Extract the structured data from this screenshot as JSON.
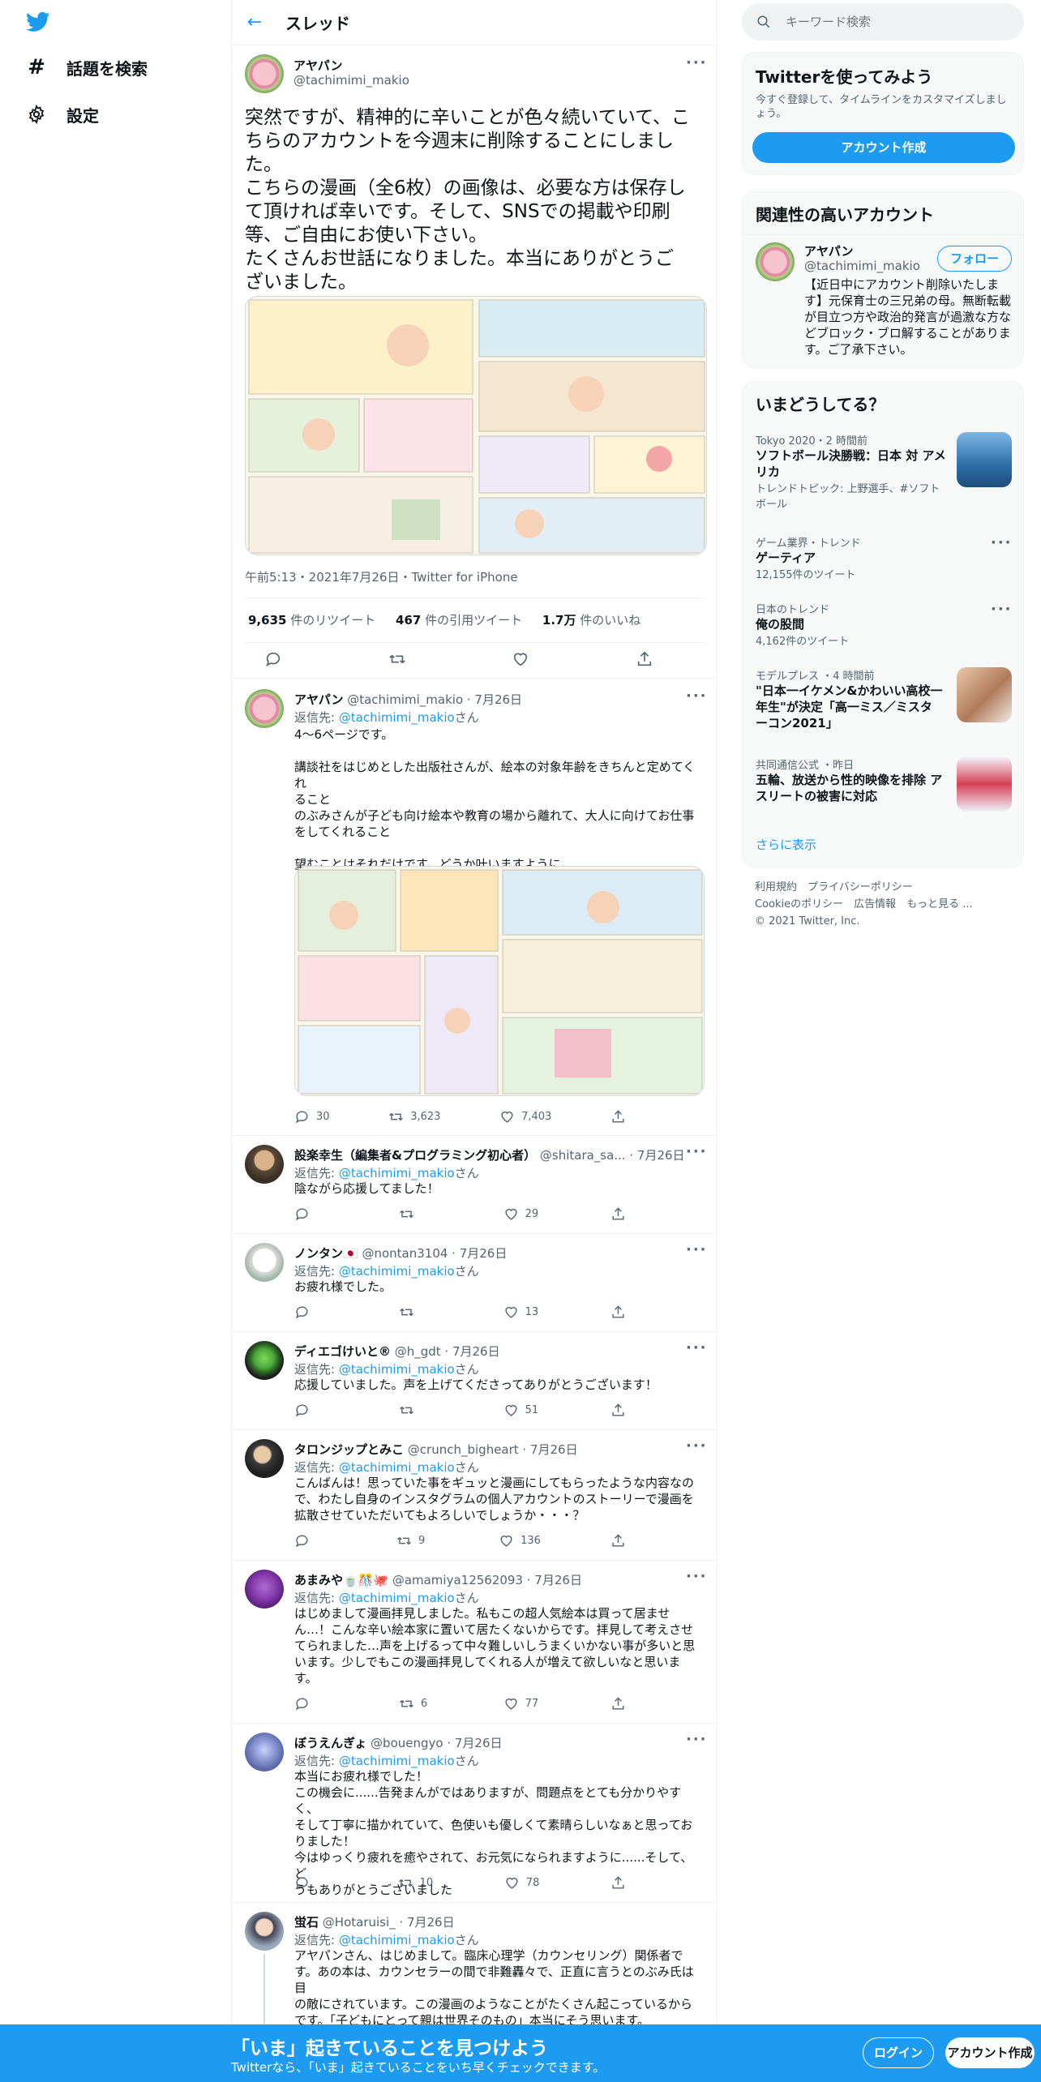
{
  "nav": {
    "explore": "話題を検索",
    "settings": "設定"
  },
  "header": {
    "title": "スレッド"
  },
  "main_tweet": {
    "name": "アヤパン",
    "handle": "@tachimimi_makio",
    "lines": [
      "突然ですが、精神的に辛いことが色々続いていて、こ",
      "ちらのアカウントを今週末に削除することにしまし",
      "た。",
      "こちらの漫画（全6枚）の画像は、必要な方は保存し",
      "て頂ければ幸いです。そして、SNSでの掲載や印刷",
      "等、ご自由にお使い下さい。",
      "たくさんお世話になりました。本当にありがとうご",
      "ざいました。"
    ],
    "timestamp": "午前5:13・2021年7月26日・Twitter for iPhone",
    "retweets": "9,635",
    "retweets_label": "件のリツイート",
    "quotes": "467",
    "quotes_label": "件の引用ツイート",
    "likes": "1.7万",
    "likes_label": "件のいいね"
  },
  "replies": [
    {
      "name": "アヤパン",
      "handle": "@tachimimi_makio · 7月26日",
      "reply_to_label": "返信先: ",
      "reply_to": "@tachimimi_makio",
      "reply_suffix": "さん",
      "lines": [
        "4〜6ページです。",
        "",
        "講談社をはじめとした出版社さんが、絵本の対象年齢をきちんと定めてくれ",
        "ること",
        "のぶみさんが子ども向け絵本や教育の場から離れて、大人に向けてお仕事",
        "をしてくれること",
        "",
        "望むことはそれだけです。どうか叶いますように。"
      ],
      "reply_count": "30",
      "retweet_count": "3,623",
      "like_count": "7,403"
    },
    {
      "name": "設楽幸生（編集者&プログラミング初心者）",
      "handle": "@shitara_sa... · 7月26日",
      "reply_to_label": "返信先: ",
      "reply_to": "@tachimimi_makio",
      "reply_suffix": "さん",
      "lines": [
        "陰ながら応援してました！"
      ],
      "reply_count": "",
      "retweet_count": "",
      "like_count": "29"
    },
    {
      "name": "ノンタン🇯🇵",
      "handle": "@nontan3104 · 7月26日",
      "reply_to_label": "返信先: ",
      "reply_to": "@tachimimi_makio",
      "reply_suffix": "さん",
      "lines": [
        "お疲れ様でした。"
      ],
      "reply_count": "",
      "retweet_count": "",
      "like_count": "13"
    },
    {
      "name": "ディエゴけいと®",
      "handle": "@h_gdt · 7月26日",
      "reply_to_label": "返信先: ",
      "reply_to": "@tachimimi_makio",
      "reply_suffix": "さん",
      "lines": [
        "応援していました。声を上げてくださってありがとうございます！"
      ],
      "reply_count": "",
      "retweet_count": "",
      "like_count": "51"
    },
    {
      "name": "タロンジップとみこ",
      "handle": "@crunch_bigheart · 7月26日",
      "reply_to_label": "返信先: ",
      "reply_to": "@tachimimi_makio",
      "reply_suffix": "さん",
      "lines": [
        "こんばんは！思っていた事をギュッと漫画にしてもらったような内容なの",
        "で、わたし自身のインスタグラムの個人アカウントのストーリーで漫画を",
        "拡散させていただいてもよろしいでしょうか・・・？"
      ],
      "reply_count": "",
      "retweet_count": "9",
      "like_count": "136"
    },
    {
      "name": "あまみや🍵🎊🐙",
      "handle": "@amamiya12562093 · 7月26日",
      "reply_to_label": "返信先: ",
      "reply_to": "@tachimimi_makio",
      "reply_suffix": "さん",
      "lines": [
        "はじめまして漫画拝見しました。私もこの超人気絵本は買って居ませ",
        "ん…！こんな辛い絵本家に置いて居たくないからです。拝見して考えさせ",
        "てられました…声を上げるって中々難しいしうまくいかない事が多いと思",
        "います。少しでもこの漫画拝見してくれる人が増えて欲しいなと思いま",
        "す。"
      ],
      "reply_count": "",
      "retweet_count": "6",
      "like_count": "77"
    },
    {
      "name": "ぼうえんぎょ",
      "handle": "@bouengyo · 7月26日",
      "reply_to_label": "返信先: ",
      "reply_to": "@tachimimi_makio",
      "reply_suffix": "さん",
      "lines": [
        "本当にお疲れ様でした！",
        "この機会に......告発まんがではありますが、問題点をとても分かりやすく、",
        "そして丁寧に描かれていて、色使いも優しくて素晴らしいなぁと思ってお",
        "りました！",
        "今はゆっくり疲れを癒やされて、お元気になられますように......そして、ど",
        "うもありがとうございました"
      ],
      "reply_count": "",
      "retweet_count": "10",
      "like_count": "78"
    },
    {
      "name": "蛍石",
      "handle": "@Hotaruisi_ · 7月26日",
      "reply_to_label": "返信先: ",
      "reply_to": "@tachimimi_makio",
      "reply_suffix": "さん",
      "lines": [
        "アヤパンさん、はじめまして。臨床心理学（カウンセリング）関係者で",
        "す。あの本は、カウンセラーの間で非難轟々で、正直に言うとのぶみ氏は目",
        "の敵にされています。この漫画のようなことがたくさん起こっているから",
        "です。「子どもにとって親は世界そのもの」本当にそう思います。"
      ]
    }
  ],
  "search": {
    "placeholder": "キーワード検索"
  },
  "signup": {
    "title": "Twitterを使ってみよう",
    "desc": "今すぐ登録して、タイムラインをカスタマイズしましょう。",
    "button": "アカウント作成"
  },
  "related": {
    "title": "関連性の高いアカウント",
    "name": "アヤパン",
    "handle": "@tachimimi_makio",
    "follow": "フォロー",
    "bio": [
      "【近日中にアカウント削除いたしま",
      "す】元保育士の三兄弟の母。無断転載",
      "が目立つ方や政治的発言が過激な方な",
      "どブロック・ブロ解することがありま",
      "す。ご了承下さい。"
    ]
  },
  "trends": {
    "title": "いまどうしてる？",
    "items": [
      {
        "meta": "Tokyo 2020・2 時間前",
        "name": "ソフトボール決勝戦：日本 対 アメリカ",
        "topic": "トレンドトピック: 上野選手、#ソフトボール"
      },
      {
        "meta": "ゲーム業界・トレンド",
        "name": "ゲーティア",
        "cnt": "12,155件のツイート"
      },
      {
        "meta": "日本のトレンド",
        "name": "俺の股間",
        "cnt": "4,162件のツイート"
      },
      {
        "meta": "モデルプレス ・4 時間前",
        "name": "\"日本一イケメン&かわいい高校一年生\"が決定「高一ミス／ミスターコン2021」"
      },
      {
        "meta": "共同通信公式 ・昨日",
        "name": "五輪、放送から性的映像を排除 アスリートの被害に対応"
      }
    ],
    "more": "さらに表示"
  },
  "footer": {
    "l1": "利用規約　プライバシーポリシー",
    "l2": "Cookieのポリシー　広告情報　もっと見る ...",
    "l3": "© 2021 Twitter, Inc."
  },
  "bottom": {
    "title": "「いま」起きていることを見つけよう",
    "sub": "Twitterなら、「いま」起きていることをいち早くチェックできます。",
    "login": "ログイン",
    "signup": "アカウント作成"
  }
}
